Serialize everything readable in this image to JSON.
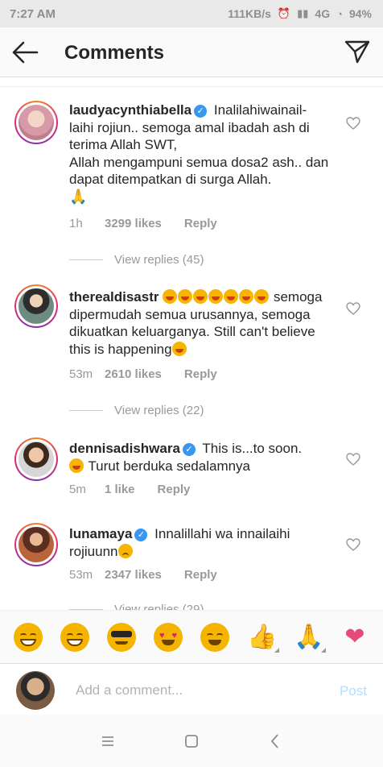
{
  "status": {
    "time": "7:27 AM",
    "speed": "111KB/s",
    "network": "4G",
    "battery": "94%"
  },
  "header": {
    "title": "Comments"
  },
  "comments": [
    {
      "username": "laudyacynthiabella",
      "verified": true,
      "text_lines": [
        "Inalilahiwainail-",
        "laihi rojiun.. semoga amal ibadah ash di terima Allah SWT,",
        "Allah mengampuni semua dosa2 ash.. dan dapat ditempatkan di surga Allah."
      ],
      "emoji_after": "folded-hands",
      "time": "1h",
      "likes": "3299 likes",
      "reply": "Reply",
      "view_replies": "View replies (45)"
    },
    {
      "username": "therealdisastr",
      "verified": false,
      "text_lines": [
        "semoga dipermudah semua urusannya, semoga dikuatkan keluarganya. Still can't believe this is happening"
      ],
      "emoji_after": "crying-face",
      "time": "53m",
      "likes": "2610 likes",
      "reply": "Reply",
      "view_replies": "View replies (22)"
    },
    {
      "username": "dennisadishwara",
      "verified": true,
      "text_lines": [
        "This is...to soon.",
        "Turut berduka sedalamnya"
      ],
      "time": "5m",
      "likes": "1 like",
      "reply": "Reply"
    },
    {
      "username": "lunamaya",
      "verified": true,
      "text_lines": [
        "Innalillahi wa innailaihi rojiuunn"
      ],
      "emoji_after": "sad-face",
      "time": "53m",
      "likes": "2347 likes",
      "reply": "Reply",
      "view_replies": "View replies (29)"
    }
  ],
  "quick_emojis": [
    "joy",
    "grin",
    "cool",
    "heart-eyes",
    "blush",
    "thumbs-up",
    "folded-hands",
    "red-heart"
  ],
  "composer": {
    "placeholder": "Add a comment...",
    "post_label": "Post"
  },
  "colors": {
    "link_blue": "#3897f0",
    "post_disabled": "#b2dffc",
    "meta_gray": "#999999",
    "heart_pink": "#e64a7a"
  }
}
